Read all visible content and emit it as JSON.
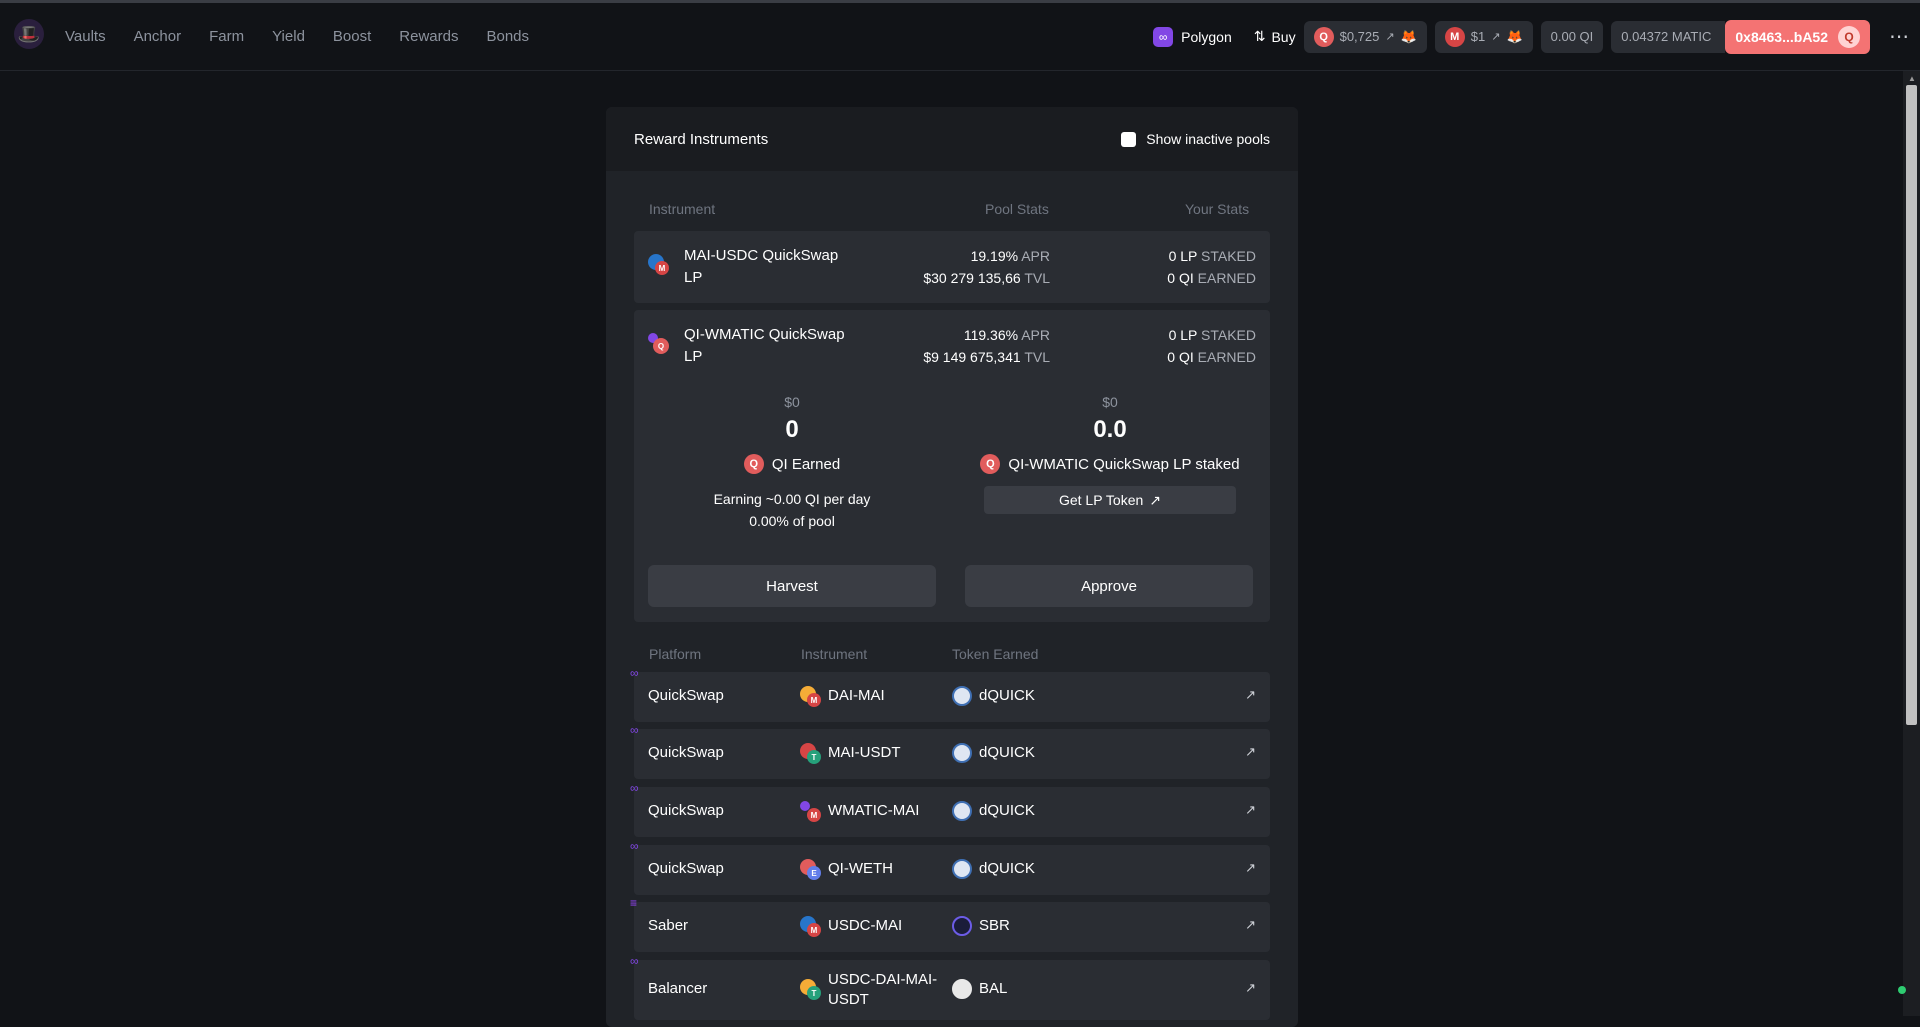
{
  "nav": {
    "items": [
      "Vaults",
      "Anchor",
      "Farm",
      "Yield",
      "Boost",
      "Rewards",
      "Bonds"
    ]
  },
  "header": {
    "network": "Polygon",
    "buy": "Buy",
    "qi_price": "$0,725",
    "mai_price": "$1",
    "qi_balance": "0.00 QI",
    "matic_balance": "0.04372 MATIC",
    "address": "0x8463...bA52"
  },
  "panel": {
    "title": "Reward Instruments",
    "show_inactive": "Show inactive pools",
    "col_instrument": "Instrument",
    "col_pool": "Pool Stats",
    "col_your": "Your Stats",
    "pools": [
      {
        "name": "MAI-USDC QuickSwap LP",
        "apr": "19.19%",
        "apr_unit": "APR",
        "tvl": "$30 279 135,66",
        "tvl_unit": "TVL",
        "staked": "0 LP",
        "staked_unit": "STAKED",
        "earned": "0 QI",
        "earned_unit": "EARNED"
      },
      {
        "name": "QI-WMATIC QuickSwap LP",
        "apr": "119.36%",
        "apr_unit": "APR",
        "tvl": "$9 149 675,341",
        "tvl_unit": "TVL",
        "staked": "0 LP",
        "staked_unit": "STAKED",
        "earned": "0 QI",
        "earned_unit": "EARNED"
      }
    ],
    "expanded": {
      "left_usd": "$0",
      "left_value": "0",
      "left_label": "QI Earned",
      "earning": "Earning ~0.00 QI per day",
      "pool_share": "0.00% of pool",
      "right_usd": "$0",
      "right_value": "0.0",
      "right_label": "QI-WMATIC QuickSwap LP staked",
      "get_lp": "Get LP Token",
      "harvest": "Harvest",
      "approve": "Approve"
    },
    "grid_hdr": {
      "platform": "Platform",
      "instrument": "Instrument",
      "token": "Token Earned"
    },
    "platforms": [
      {
        "platform": "QuickSwap",
        "instrument": "DAI-MAI",
        "token": "dQUICK"
      },
      {
        "platform": "QuickSwap",
        "instrument": "MAI-USDT",
        "token": "dQUICK"
      },
      {
        "platform": "QuickSwap",
        "instrument": "WMATIC-MAI",
        "token": "dQUICK"
      },
      {
        "platform": "QuickSwap",
        "instrument": "QI-WETH",
        "token": "dQUICK"
      },
      {
        "platform": "Saber",
        "instrument": "USDC-MAI",
        "token": "SBR"
      },
      {
        "platform": "Balancer",
        "instrument": "USDC-DAI-MAI-USDT",
        "token": "BAL"
      }
    ]
  },
  "colors": {
    "accent": "#f47373",
    "polygon": "#8247e5",
    "qi": "#e15c5c"
  }
}
